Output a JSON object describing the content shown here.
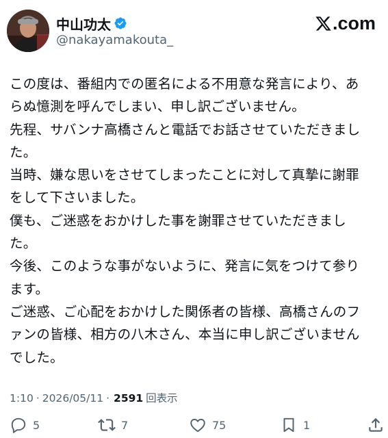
{
  "author": {
    "display_name": "中山功太",
    "handle": "@nakayamakouta_",
    "verified": true
  },
  "brand": {
    "domain_text": ".com"
  },
  "post": {
    "lines": [
      "この度は、番組内での匿名による不用意な発言により、あ",
      "らぬ憶測を呼んでしまい、申し訳ございません。",
      "先程、サバンナ高橋さんと電話でお話させていただきまし",
      "た。",
      "当時、嫌な思いをさせてしまったことに対して真摯に謝罪",
      "をして下さいました。",
      "僕も、ご迷惑をおかけした事を謝罪させていただきまし",
      "た。",
      "今後、このような事がないように、発言に気をつけて参り",
      "ます。",
      "ご迷惑、ご心配をおかけした関係者の皆様、高橋さんのフ",
      "ァンの皆様、相方の八木さん、本当に申し訳ございません",
      "でした。"
    ]
  },
  "meta": {
    "time": "1:10",
    "separator": "·",
    "date": "2026/05/11",
    "separator2": "·",
    "views_count": "2591",
    "views_label": "回表示"
  },
  "actions": {
    "replies": "5",
    "reposts": "7",
    "likes": "75",
    "bookmarks": "1"
  },
  "colors": {
    "text": "#0f1419",
    "secondary": "#536471",
    "verified_blue": "#1d9bf0"
  },
  "icons": [
    "verified-badge-icon",
    "x-logo-icon",
    "reply-icon",
    "repost-icon",
    "like-icon",
    "bookmark-icon",
    "share-icon"
  ]
}
